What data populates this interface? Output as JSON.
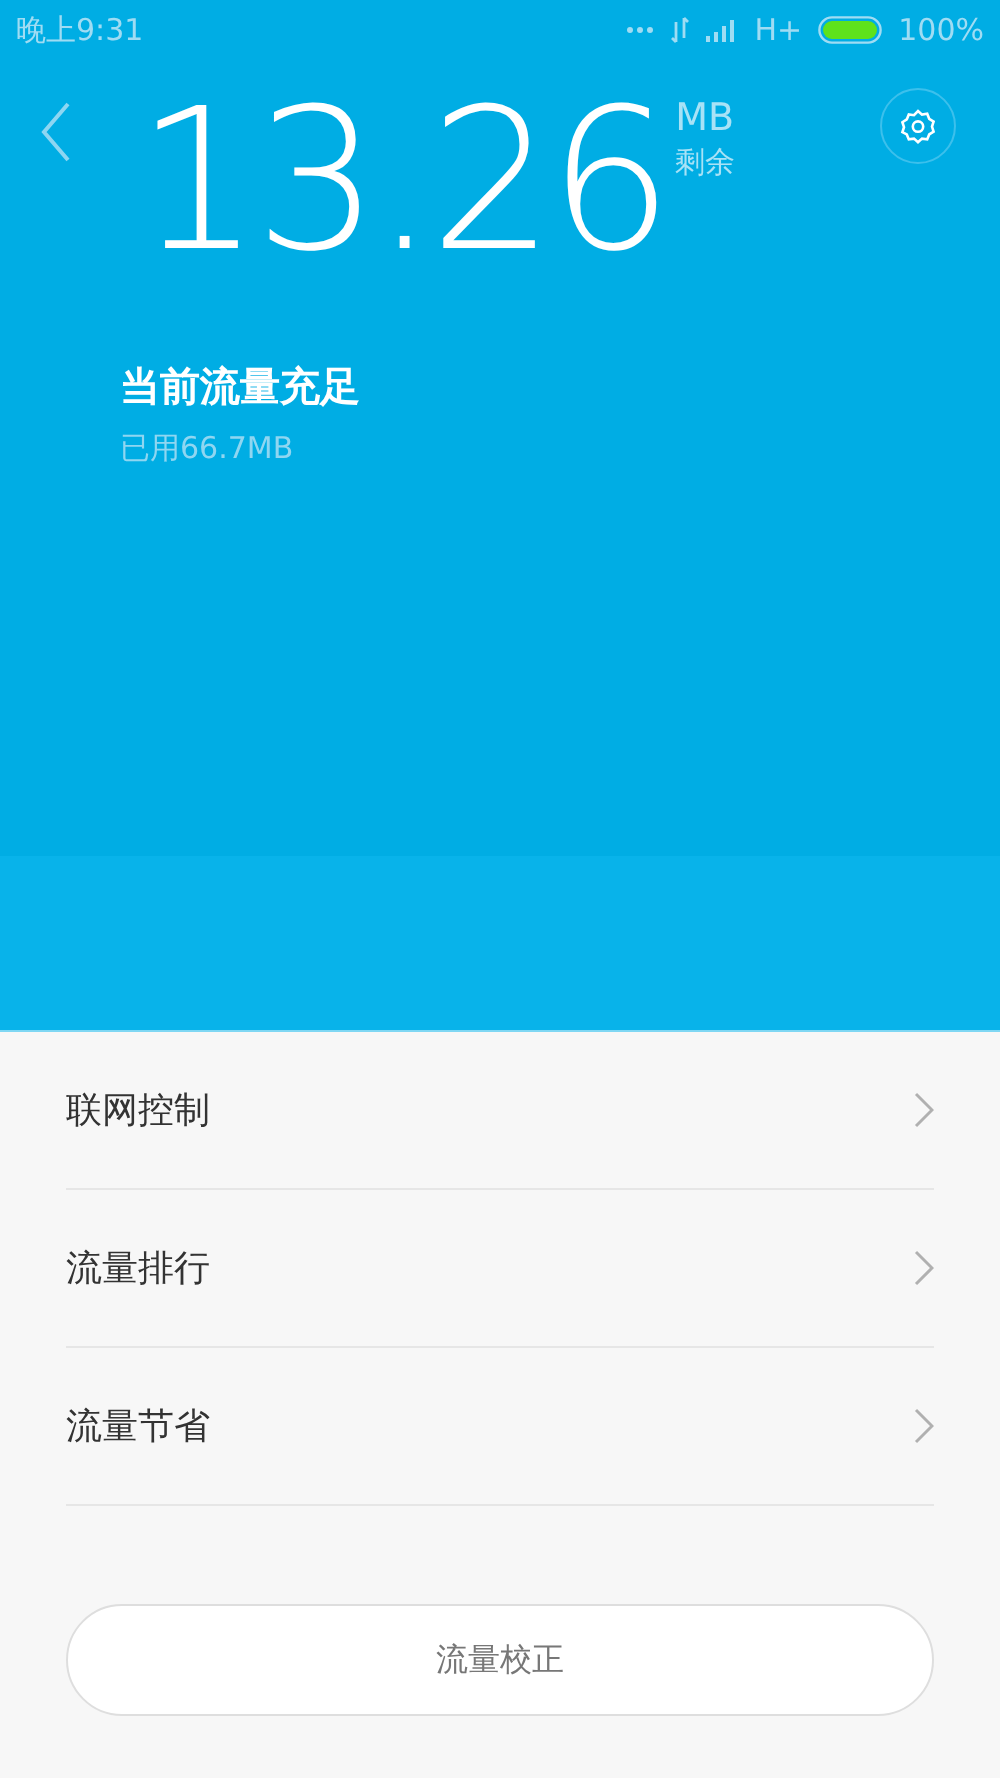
{
  "status_bar": {
    "time": "晚上9:31",
    "network": "H+",
    "battery_percent": "100%"
  },
  "header": {
    "remaining": "13.26",
    "unit": "MB",
    "unit_caption": "剩余",
    "status": "当前流量充足",
    "used": "已用66.7MB"
  },
  "menu": [
    {
      "label": "联网控制"
    },
    {
      "label": "流量排行"
    },
    {
      "label": "流量节省"
    }
  ],
  "calibrate_button": "流量校正"
}
